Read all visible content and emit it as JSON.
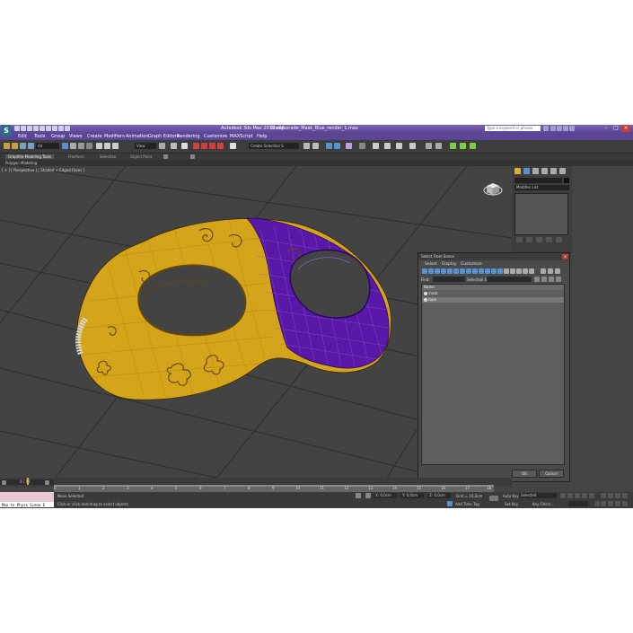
{
  "app": {
    "title": "Autodesk 3ds Max 2012 x64",
    "file": "Masquerade_Mask_Blue_render_1.max",
    "search_placeholder": "Type a keyword or phrase",
    "logo_letter": "S"
  },
  "menu": [
    "Edit",
    "Tools",
    "Group",
    "Views",
    "Create",
    "Modifiers",
    "Animation",
    "Graph Editors",
    "Rendering",
    "Customize",
    "MAXScript",
    "Help"
  ],
  "toolbar": {
    "selection_filter": "All",
    "ref_coord": "View",
    "named_selection": "Create Selection S"
  },
  "ribbon": {
    "tabs": [
      "Graphite Modeling Tools",
      "Freeform",
      "Selection",
      "Object Paint"
    ],
    "active_tab": "Graphite Modeling Tools",
    "panel": "Polygon Modeling"
  },
  "viewport": {
    "label": "[ + ] [ Perspective ] [ Shaded + Edged Faces ]"
  },
  "command_panel": {
    "modifier_list": "Modifier List"
  },
  "dialog": {
    "title": "Select From Scene",
    "menu": [
      "Select",
      "Display",
      "Customize"
    ],
    "find_label": "Find:",
    "selection_set_label": "Selection Set:",
    "column_header": "Name",
    "rows": [
      "mask",
      "rope"
    ],
    "ok": "OK",
    "cancel": "Cancel"
  },
  "timeline": {
    "counter": "0 / 18",
    "ticks": [
      "0",
      "1",
      "2",
      "3",
      "4",
      "5",
      "6",
      "7",
      "8",
      "9",
      "10",
      "11",
      "12",
      "13",
      "14",
      "15",
      "16",
      "17",
      "18"
    ]
  },
  "status": {
    "script_text": "Max to Physx Scene E",
    "selection_info": "None Selected",
    "prompt": "Click or click-and-drag to select objects",
    "grid": "Grid = 10,0cm",
    "add_time_tag": "Add Time Tag",
    "auto_key": "Auto Key",
    "auto_key_value": "Selected",
    "set_key": "Set Key",
    "key_filters": "Key Filters...",
    "x_field": "X: 0,0cm",
    "y_field": "Y: 0,0cm",
    "z_field": "Z: 0,0cm"
  },
  "colors": {
    "mask_gold": "#d4a41a",
    "mask_purple": "#5a18a8",
    "viewport_bg": "#434343",
    "title_purple": "#6a55a8"
  }
}
